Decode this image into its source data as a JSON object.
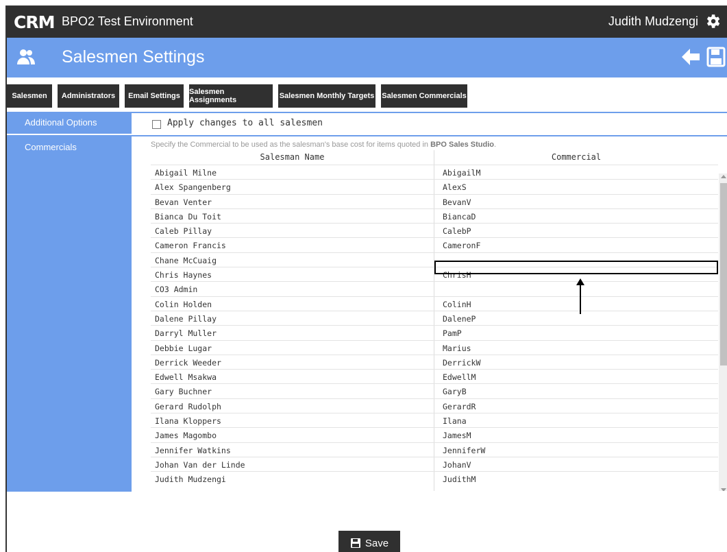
{
  "topbar": {
    "logo": "CRM",
    "environment": "BPO2 Test Environment",
    "user_name": "Judith Mudzengi",
    "settings_icon": "gear-icon"
  },
  "header": {
    "title": "Salesmen Settings",
    "icon": "people-icon",
    "back_icon": "arrow-left-icon",
    "save_icon": "floppy-icon"
  },
  "tabs": [
    {
      "label": "Salesmen"
    },
    {
      "label": "Administrators"
    },
    {
      "label": "Email Settings"
    },
    {
      "label": "Salesmen Assignments"
    },
    {
      "label": "Salesmen Monthly Targets"
    },
    {
      "label": "Salesmen Commercials",
      "active": true
    }
  ],
  "sidebar": {
    "items": [
      {
        "label": "Additional Options"
      },
      {
        "label": "Commercials"
      }
    ]
  },
  "apply": {
    "label": "Apply changes to all salesmen",
    "checked": false
  },
  "description": {
    "text": "Specify the Commercial to be used as the salesman's base cost for items quoted in ",
    "bold": "BPO Sales Studio",
    "end": "."
  },
  "table": {
    "columns": [
      "Salesman Name",
      "Commercial"
    ],
    "rows": [
      {
        "name": "Abigail Milne",
        "commercial": "AbigailM"
      },
      {
        "name": "Alex Spangenberg",
        "commercial": "AlexS"
      },
      {
        "name": "Bevan Venter",
        "commercial": "BevanV"
      },
      {
        "name": "Bianca Du Toit",
        "commercial": "BiancaD"
      },
      {
        "name": "Caleb Pillay",
        "commercial": "CalebP"
      },
      {
        "name": "Cameron Francis",
        "commercial": "CameronF"
      },
      {
        "name": "Chane McCuaig",
        "commercial": ""
      },
      {
        "name": "Chris Haynes",
        "commercial": "ChrisH"
      },
      {
        "name": "CO3 Admin",
        "commercial": ""
      },
      {
        "name": "Colin Holden",
        "commercial": "ColinH"
      },
      {
        "name": "Dalene Pillay",
        "commercial": "DaleneP"
      },
      {
        "name": "Darryl Muller",
        "commercial": "PamP"
      },
      {
        "name": "Debbie Lugar",
        "commercial": "Marius"
      },
      {
        "name": "Derrick Weeder",
        "commercial": "DerrickW"
      },
      {
        "name": "Edwell Msakwa",
        "commercial": "EdwellM"
      },
      {
        "name": "Gary Buchner",
        "commercial": "GaryB"
      },
      {
        "name": "Gerard Rudolph",
        "commercial": "GerardR"
      },
      {
        "name": "Ilana Kloppers",
        "commercial": "Ilana"
      },
      {
        "name": "James Magombo",
        "commercial": "JamesM"
      },
      {
        "name": "Jennifer Watkins",
        "commercial": "JenniferW"
      },
      {
        "name": "Johan Van der Linde",
        "commercial": "JohanV"
      },
      {
        "name": "Judith Mudzengi",
        "commercial": "JudithM"
      }
    ]
  },
  "save_button": {
    "label": "Save",
    "icon": "floppy-icon"
  },
  "colors": {
    "accent": "#6d9eeb",
    "dark": "#303030"
  }
}
